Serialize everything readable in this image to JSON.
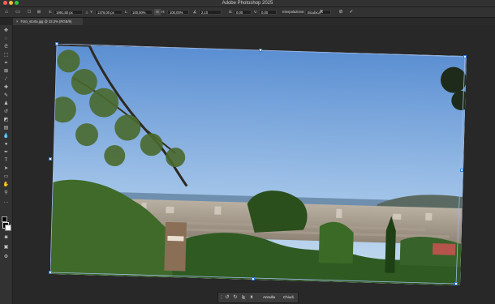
{
  "app": {
    "title": "Adobe Photoshop 2025"
  },
  "options_bar": {
    "x_label": "X:",
    "x_value": "1991,50 px",
    "y_label": "Y:",
    "y_value": "1378,00 px",
    "w_label": "L:",
    "w_value": "100,00%",
    "h_label": "H:",
    "h_value": "100,00%",
    "angle_value": "2,10",
    "hskew_label": "O:",
    "hskew_value": "0,00",
    "vskew_label": "V:",
    "vskew_value": "0,00",
    "interp_label": "Interpolazione:",
    "interp_value": "Bicubica"
  },
  "tab": {
    "label": "Foto_storta.jpg @ 33,3% (RGB/8)"
  },
  "context_bar": {
    "cancel_label": "Annulla",
    "close_label": "Chiudi"
  },
  "colors": {
    "accent": "#2d7ce8",
    "panel": "#323232",
    "canvas": "#282828"
  }
}
